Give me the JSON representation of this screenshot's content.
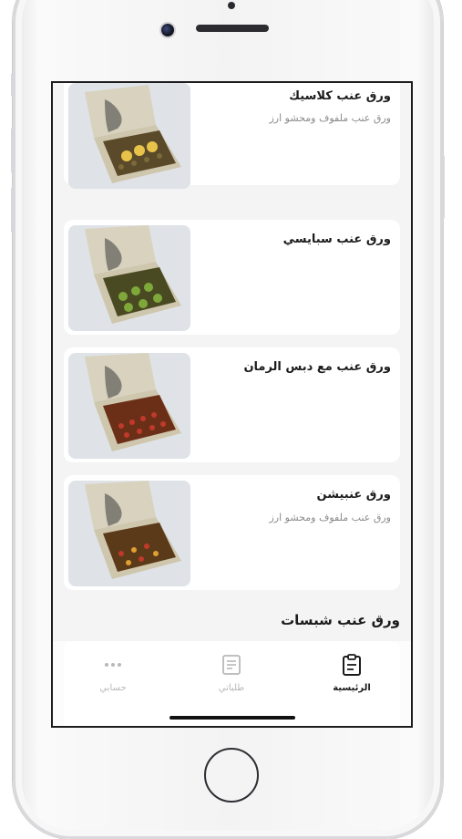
{
  "items": [
    {
      "title": "ورق عنب كلاسيك",
      "subtitle": "ورق عنب ملفوف ومحشو ارز",
      "image": "grape-leaves-box-lemon"
    },
    {
      "title": "ورق عنب سبايسي",
      "subtitle": "",
      "image": "grape-leaves-box-spicy"
    },
    {
      "title": "ورق عنب مع دبس الرمان",
      "subtitle": "",
      "image": "grape-leaves-box-pomegranate"
    },
    {
      "title": "ورق عنبيشن",
      "subtitle": "ورق عنب ملفوف ومحشو ارز",
      "image": "grape-leaves-box-mix"
    }
  ],
  "section": {
    "title": "ورق عنب شبسات"
  },
  "tabs": [
    {
      "label": "الرئيسية",
      "icon": "clipboard-icon",
      "active": true
    },
    {
      "label": "طلباتي",
      "icon": "orders-icon",
      "active": false
    },
    {
      "label": "حسابي",
      "icon": "more-dots-icon",
      "active": false
    }
  ],
  "colors": {
    "active_tab": "#1b1b1b",
    "inactive_tab": "#b8b8b8",
    "card": "#ffffff",
    "screen_bg": "#f4f4f5"
  }
}
